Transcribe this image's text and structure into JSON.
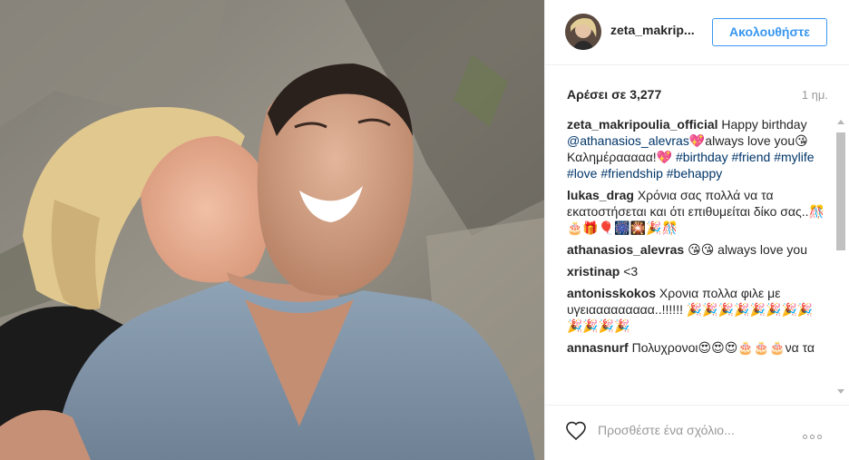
{
  "header": {
    "username": "zeta_makrip...",
    "follow_label": "Ακολουθήστε"
  },
  "stats": {
    "likes": "Αρέσει σε 3,277",
    "time": "1 ημ."
  },
  "caption": {
    "user": "zeta_makripoulia_official",
    "text1": " Happy birthday ",
    "mention": "@athanasios_alevras",
    "text2": "💖always love you😘 Καλημέρααααα!💖 ",
    "hashtags": [
      "#birthday",
      "#friend",
      "#mylife",
      "#love",
      "#friendship",
      "#behappy"
    ]
  },
  "comments": [
    {
      "user": "lukas_drag",
      "text": " Χρόνια σας πολλά να τα εκατοστήσεται και ότι επιθυμείται δίκο σας..🎊🎂🎁🎈🎆🎇🎉🎊"
    },
    {
      "user": "athanasios_alevras",
      "text": " 😘😘 always love you"
    },
    {
      "user": "xristinap",
      "text": " <3"
    },
    {
      "user": "antonisskokos",
      "text": " Χρονια πολλα φιλε με υγειααααααααα..!!!!!! 🎉🎉🎉🎉🎉🎉🎉🎉 🎉🎉🎉🎉"
    },
    {
      "user": "annasnurf",
      "text": " Πολυχρονοι😍😍😍🎂🎂🎂να τα"
    }
  ],
  "footer": {
    "comment_placeholder": "Προσθέστε ένα σχόλιο..."
  },
  "icons": {
    "like": "heart-outline-icon",
    "more": "more-options-icon"
  },
  "colors": {
    "accent": "#3897f0",
    "hashtag": "#003569",
    "muted": "#999999"
  }
}
